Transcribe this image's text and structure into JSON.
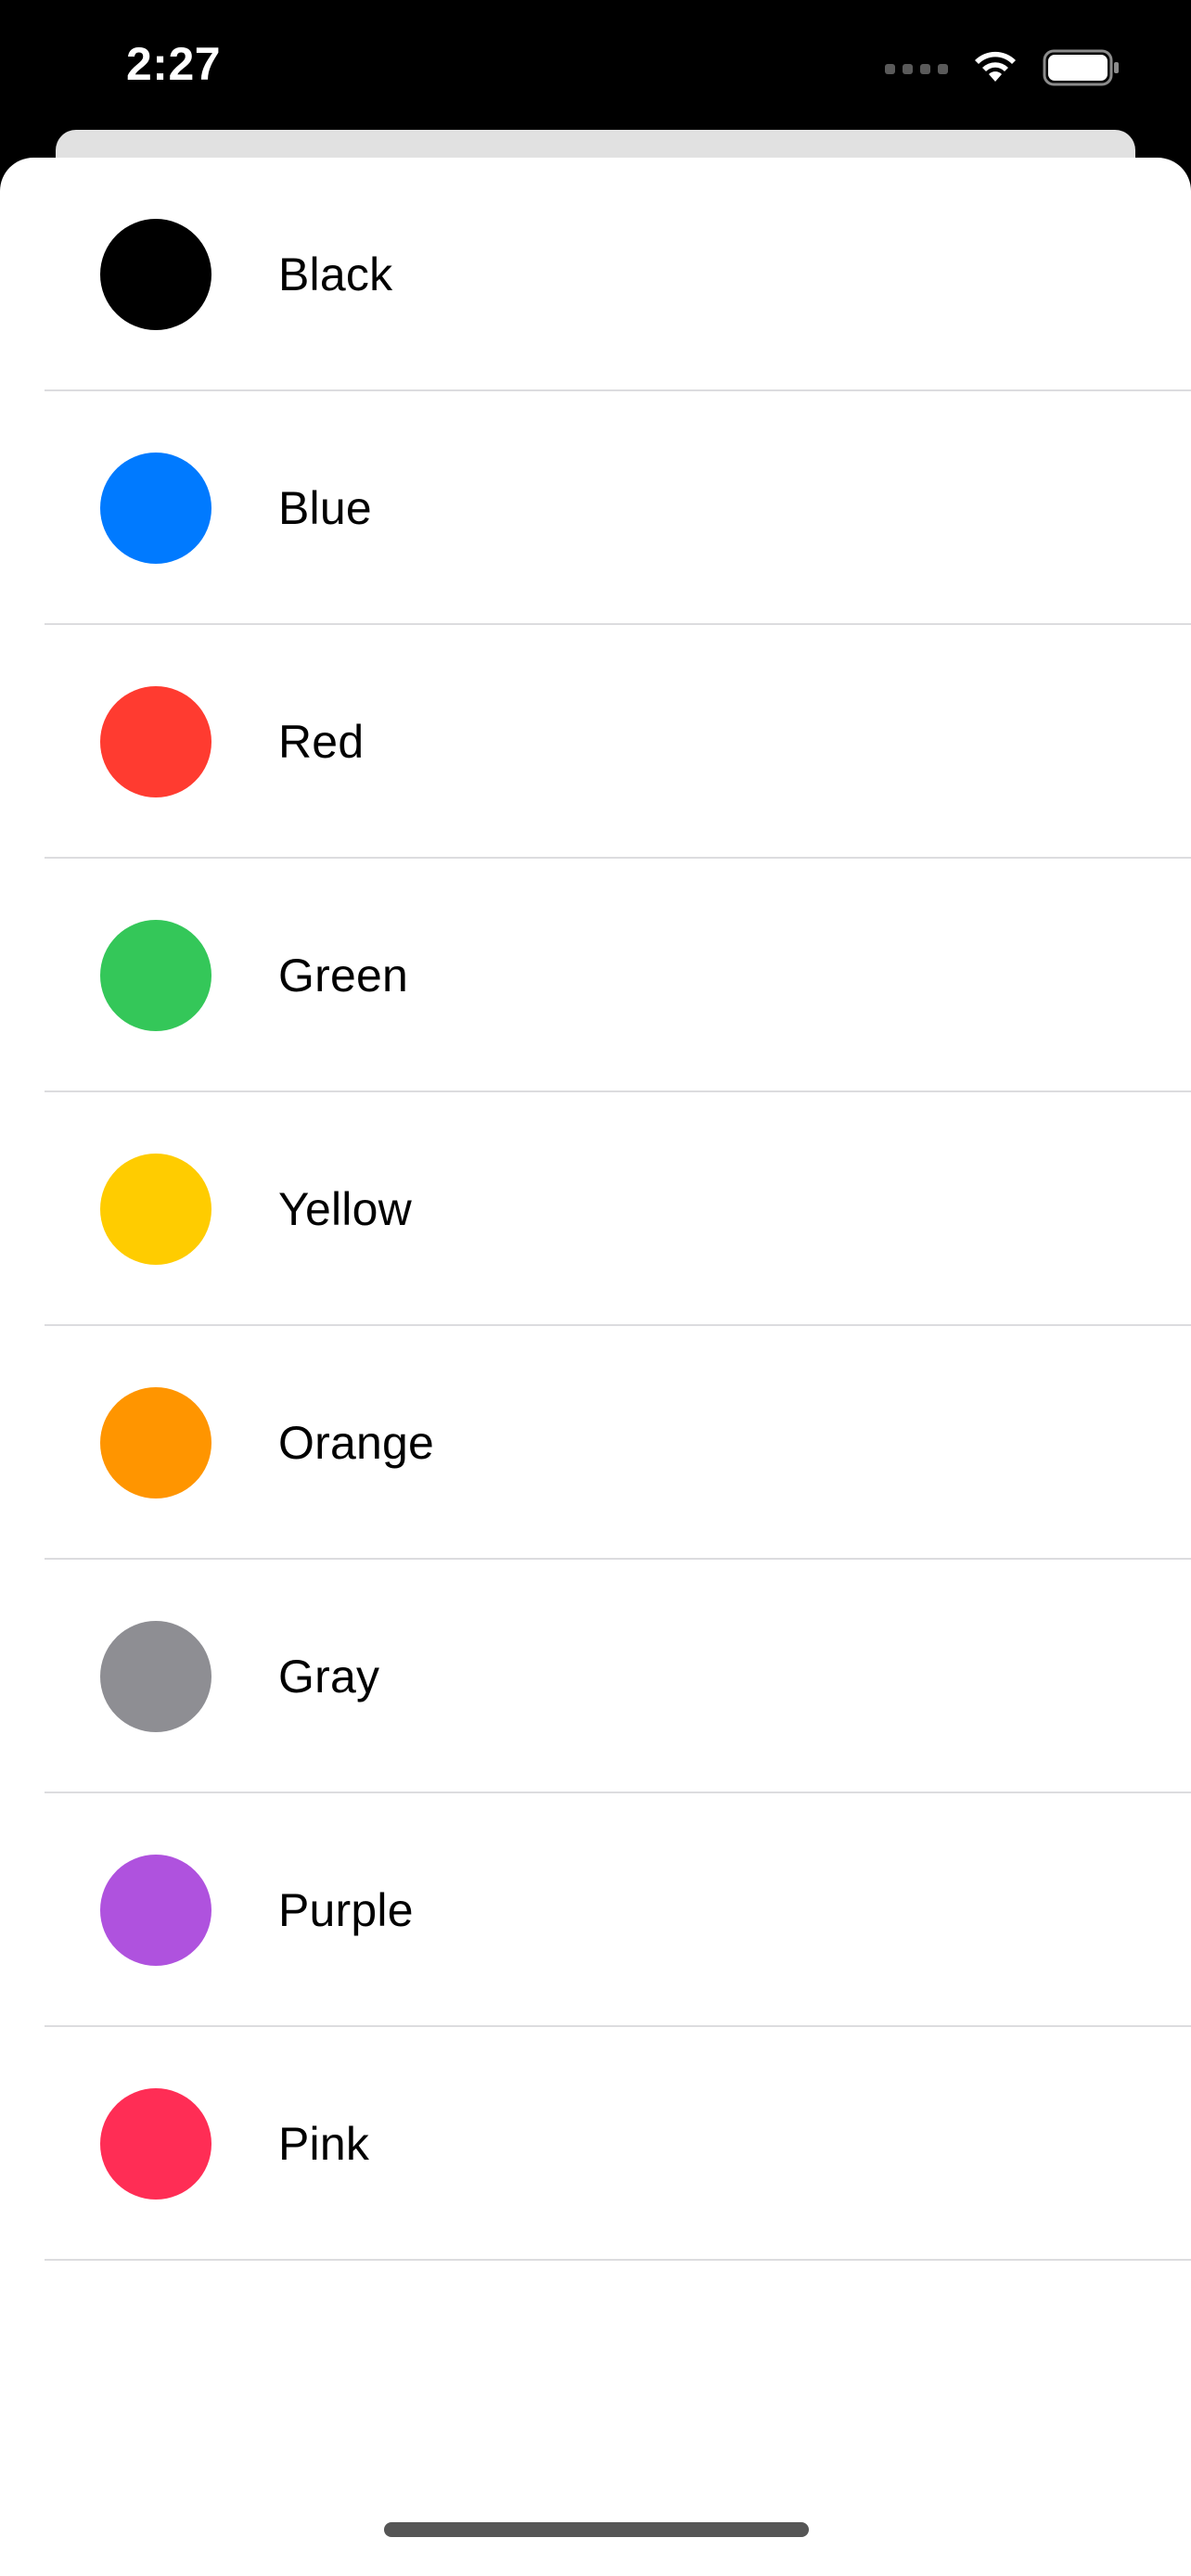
{
  "status_bar": {
    "time": "2:27",
    "icons": [
      "cellular-signal-icon",
      "wifi-icon",
      "battery-icon"
    ]
  },
  "colors": [
    {
      "label": "Black",
      "hex": "#000000"
    },
    {
      "label": "Blue",
      "hex": "#007AFF"
    },
    {
      "label": "Red",
      "hex": "#FF3B30"
    },
    {
      "label": "Green",
      "hex": "#34C759"
    },
    {
      "label": "Yellow",
      "hex": "#FFCC00"
    },
    {
      "label": "Orange",
      "hex": "#FF9500"
    },
    {
      "label": "Gray",
      "hex": "#8E8E93"
    },
    {
      "label": "Purple",
      "hex": "#AF52DE"
    },
    {
      "label": "Pink",
      "hex": "#FF2D55"
    }
  ],
  "theme": {
    "sheet_background": "#FFFFFF",
    "back_sheet": "#E1E1E1",
    "separator": "#DCDCDF",
    "status_bar_background": "#000000"
  }
}
